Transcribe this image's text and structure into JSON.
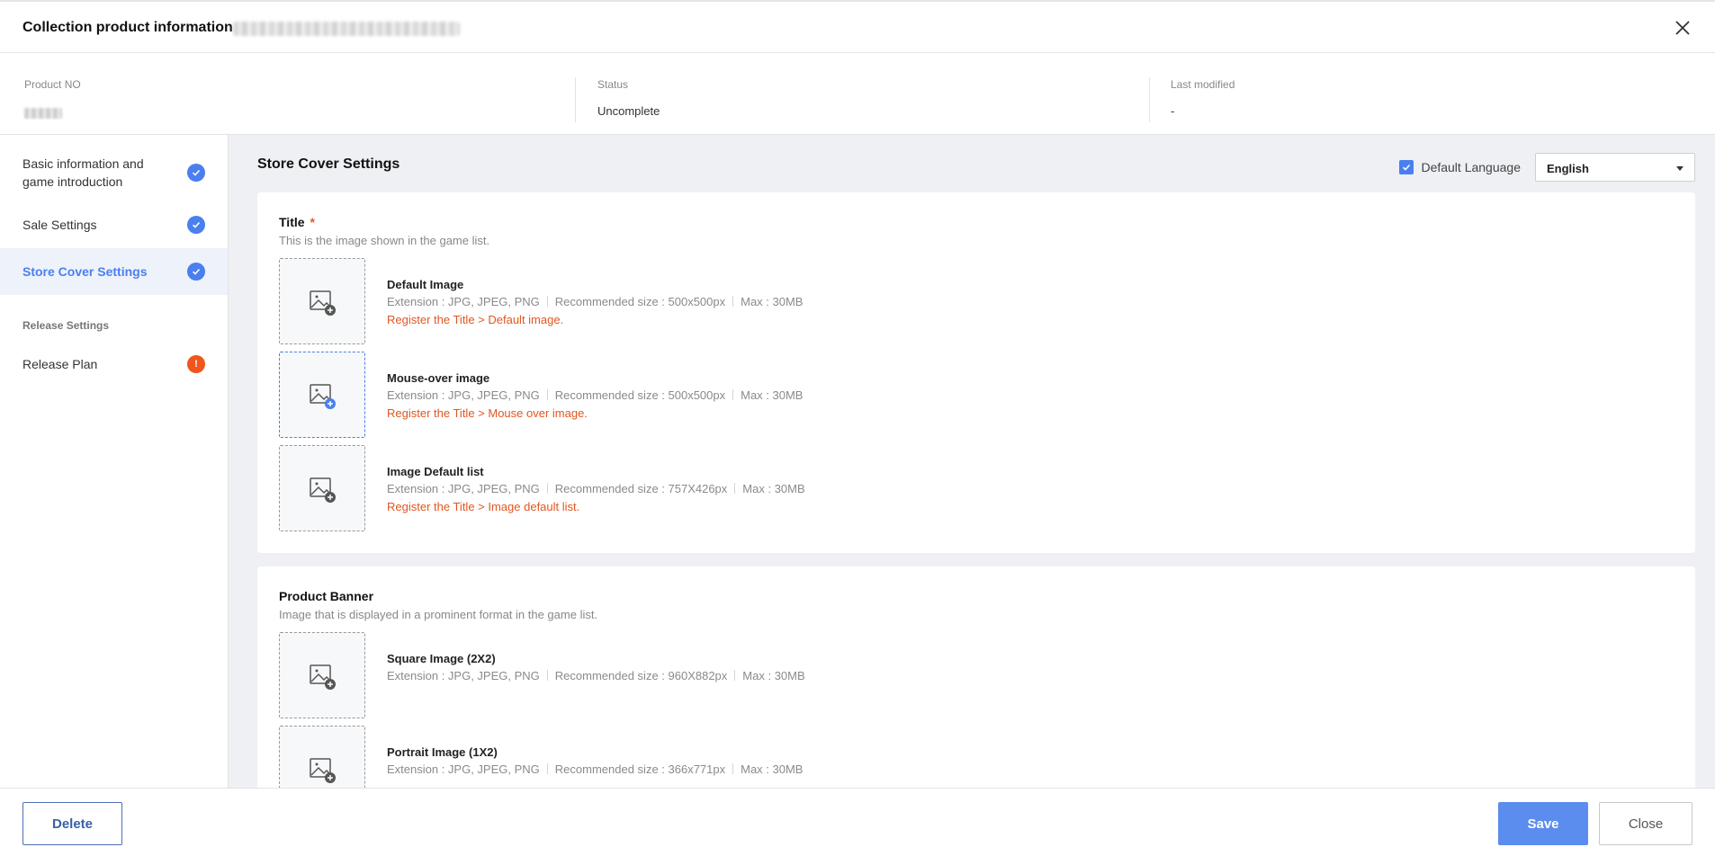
{
  "header": {
    "title": "Collection product information",
    "close_icon": "close-icon"
  },
  "info": {
    "product_no_label": "Product NO",
    "status_label": "Status",
    "status_value": "Uncomplete",
    "last_modified_label": "Last modified",
    "last_modified_value": "-"
  },
  "sidebar": {
    "items": [
      {
        "label": "Basic information and game introduction",
        "status": "complete"
      },
      {
        "label": "Sale Settings",
        "status": "complete"
      },
      {
        "label": "Store Cover Settings",
        "status": "complete",
        "active": true
      }
    ],
    "section_label": "Release Settings",
    "release_item": {
      "label": "Release Plan",
      "status": "warning",
      "badge_text": "!"
    }
  },
  "main": {
    "heading": "Store Cover Settings",
    "default_language_label": "Default Language",
    "default_language_checked": true,
    "language_value": "English",
    "title_card": {
      "title": "Title",
      "required_mark": "*",
      "description": "This is the image shown in the game list.",
      "images": [
        {
          "name": "Default Image",
          "extension": "Extension : JPG, JPEG, PNG",
          "size": "Recommended size : 500x500px",
          "max": "Max : 30MB",
          "error": "Register the Title > Default image."
        },
        {
          "name": "Mouse-over image",
          "extension": "Extension : JPG, JPEG, PNG",
          "size": "Recommended size : 500x500px",
          "max": "Max : 30MB",
          "error": "Register the Title > Mouse over image."
        },
        {
          "name": "Image Default list",
          "extension": "Extension : JPG, JPEG, PNG",
          "size": "Recommended size : 757X426px",
          "max": "Max : 30MB",
          "error": "Register the Title > Image default list."
        }
      ]
    },
    "banner_card": {
      "title": "Product Banner",
      "description": "Image that is displayed in a prominent format in the game list.",
      "images": [
        {
          "name": "Square Image (2X2)",
          "extension": "Extension : JPG, JPEG, PNG",
          "size": "Recommended size : 960X882px",
          "max": "Max : 30MB"
        },
        {
          "name": "Portrait Image (1X2)",
          "extension": "Extension : JPG, JPEG, PNG",
          "size": "Recommended size : 366x771px",
          "max": "Max : 30MB"
        }
      ]
    }
  },
  "footer": {
    "delete_label": "Delete",
    "save_label": "Save",
    "close_label": "Close"
  },
  "colors": {
    "accent": "#4a7ff0",
    "warning": "#f0561c",
    "error_text": "#e2561f"
  }
}
